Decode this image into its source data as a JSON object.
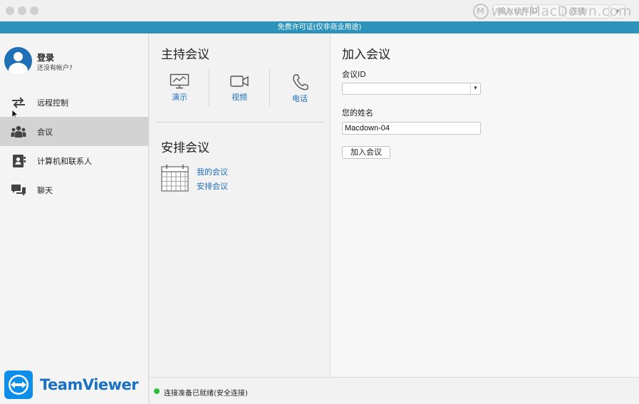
{
  "titlebar": {
    "partial_buttons": [
      "输入伙伴ID",
      "连接"
    ],
    "watermark": "www.MacDown.com",
    "watermark_logo": "M"
  },
  "banner": {
    "text": "免费许可证(仅非商业用途)"
  },
  "sidebar": {
    "account": {
      "title": "登录",
      "subtitle": "还没有帐户?"
    },
    "items": [
      {
        "label": "远程控制",
        "icon": "arrows-icon"
      },
      {
        "label": "会议",
        "icon": "people-icon",
        "active": true
      },
      {
        "label": "计算机和联系人",
        "icon": "contacts-icon"
      },
      {
        "label": "聊天",
        "icon": "chat-icon"
      }
    ],
    "brand": "TeamViewer"
  },
  "host": {
    "title": "主持会议",
    "buttons": [
      {
        "label": "演示",
        "icon": "presentation-icon"
      },
      {
        "label": "视频",
        "icon": "video-camera-icon"
      },
      {
        "label": "电话",
        "icon": "phone-icon"
      }
    ]
  },
  "schedule": {
    "title": "安排会议",
    "links": [
      "我的会议",
      "安排会议"
    ]
  },
  "join": {
    "title": "加入会议",
    "id_label": "会议ID",
    "id_value": "",
    "name_label": "您的姓名",
    "name_value": "Macdown-04",
    "button": "加入会议"
  },
  "status": {
    "text": "连接准备已就绪(安全连接)",
    "color": "#2ebd3b"
  },
  "colors": {
    "banner": "#2d93ba",
    "link": "#1f6fc0",
    "brand": "#1a71c4"
  }
}
